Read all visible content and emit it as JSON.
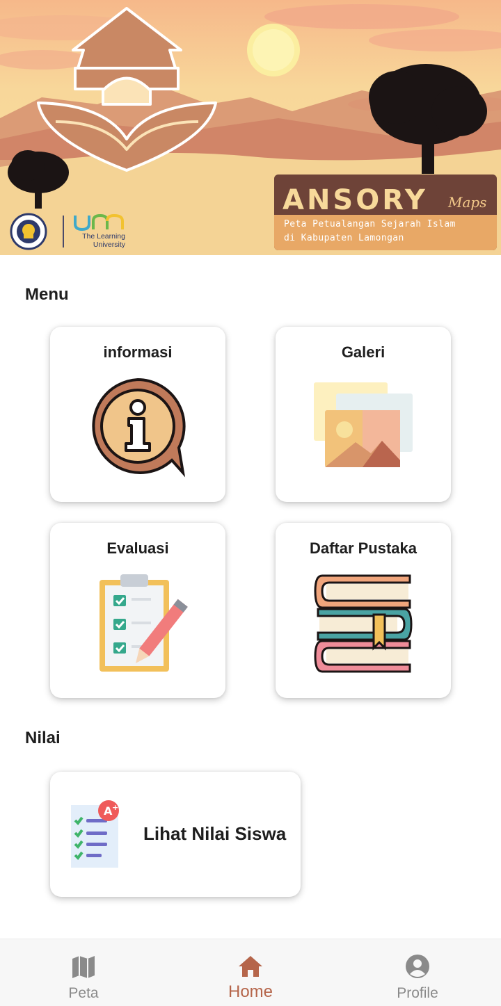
{
  "banner": {
    "brand_title": "ANSORY",
    "brand_suffix": "Maps",
    "brand_subtitle_line1": "Peta Petualangan Sejarah Islam",
    "brand_subtitle_line2": "di Kabupaten Lamongan",
    "university_word": "um",
    "university_tag_line1": "The Learning",
    "university_tag_line2": "University"
  },
  "menu": {
    "title": "Menu",
    "items": [
      {
        "label": "informasi",
        "icon": "info-icon"
      },
      {
        "label": "Galeri",
        "icon": "gallery-icon"
      },
      {
        "label": "Evaluasi",
        "icon": "clipboard-checklist-icon"
      },
      {
        "label": "Daftar Pustaka",
        "icon": "books-stack-icon"
      }
    ]
  },
  "nilai": {
    "title": "Nilai",
    "card_label": "Lihat Nilai Siswa",
    "card_icon": "grade-report-icon"
  },
  "bottom_nav": {
    "items": [
      {
        "label": "Peta",
        "icon": "map-icon",
        "active": false
      },
      {
        "label": "Home",
        "icon": "home-icon",
        "active": true
      },
      {
        "label": "Profile",
        "icon": "profile-icon",
        "active": false
      }
    ]
  },
  "colors": {
    "accent": "#b5654a",
    "inactive": "#8a8a8a",
    "brand_dark": "#6e4338",
    "brand_orange": "#e8a866"
  }
}
